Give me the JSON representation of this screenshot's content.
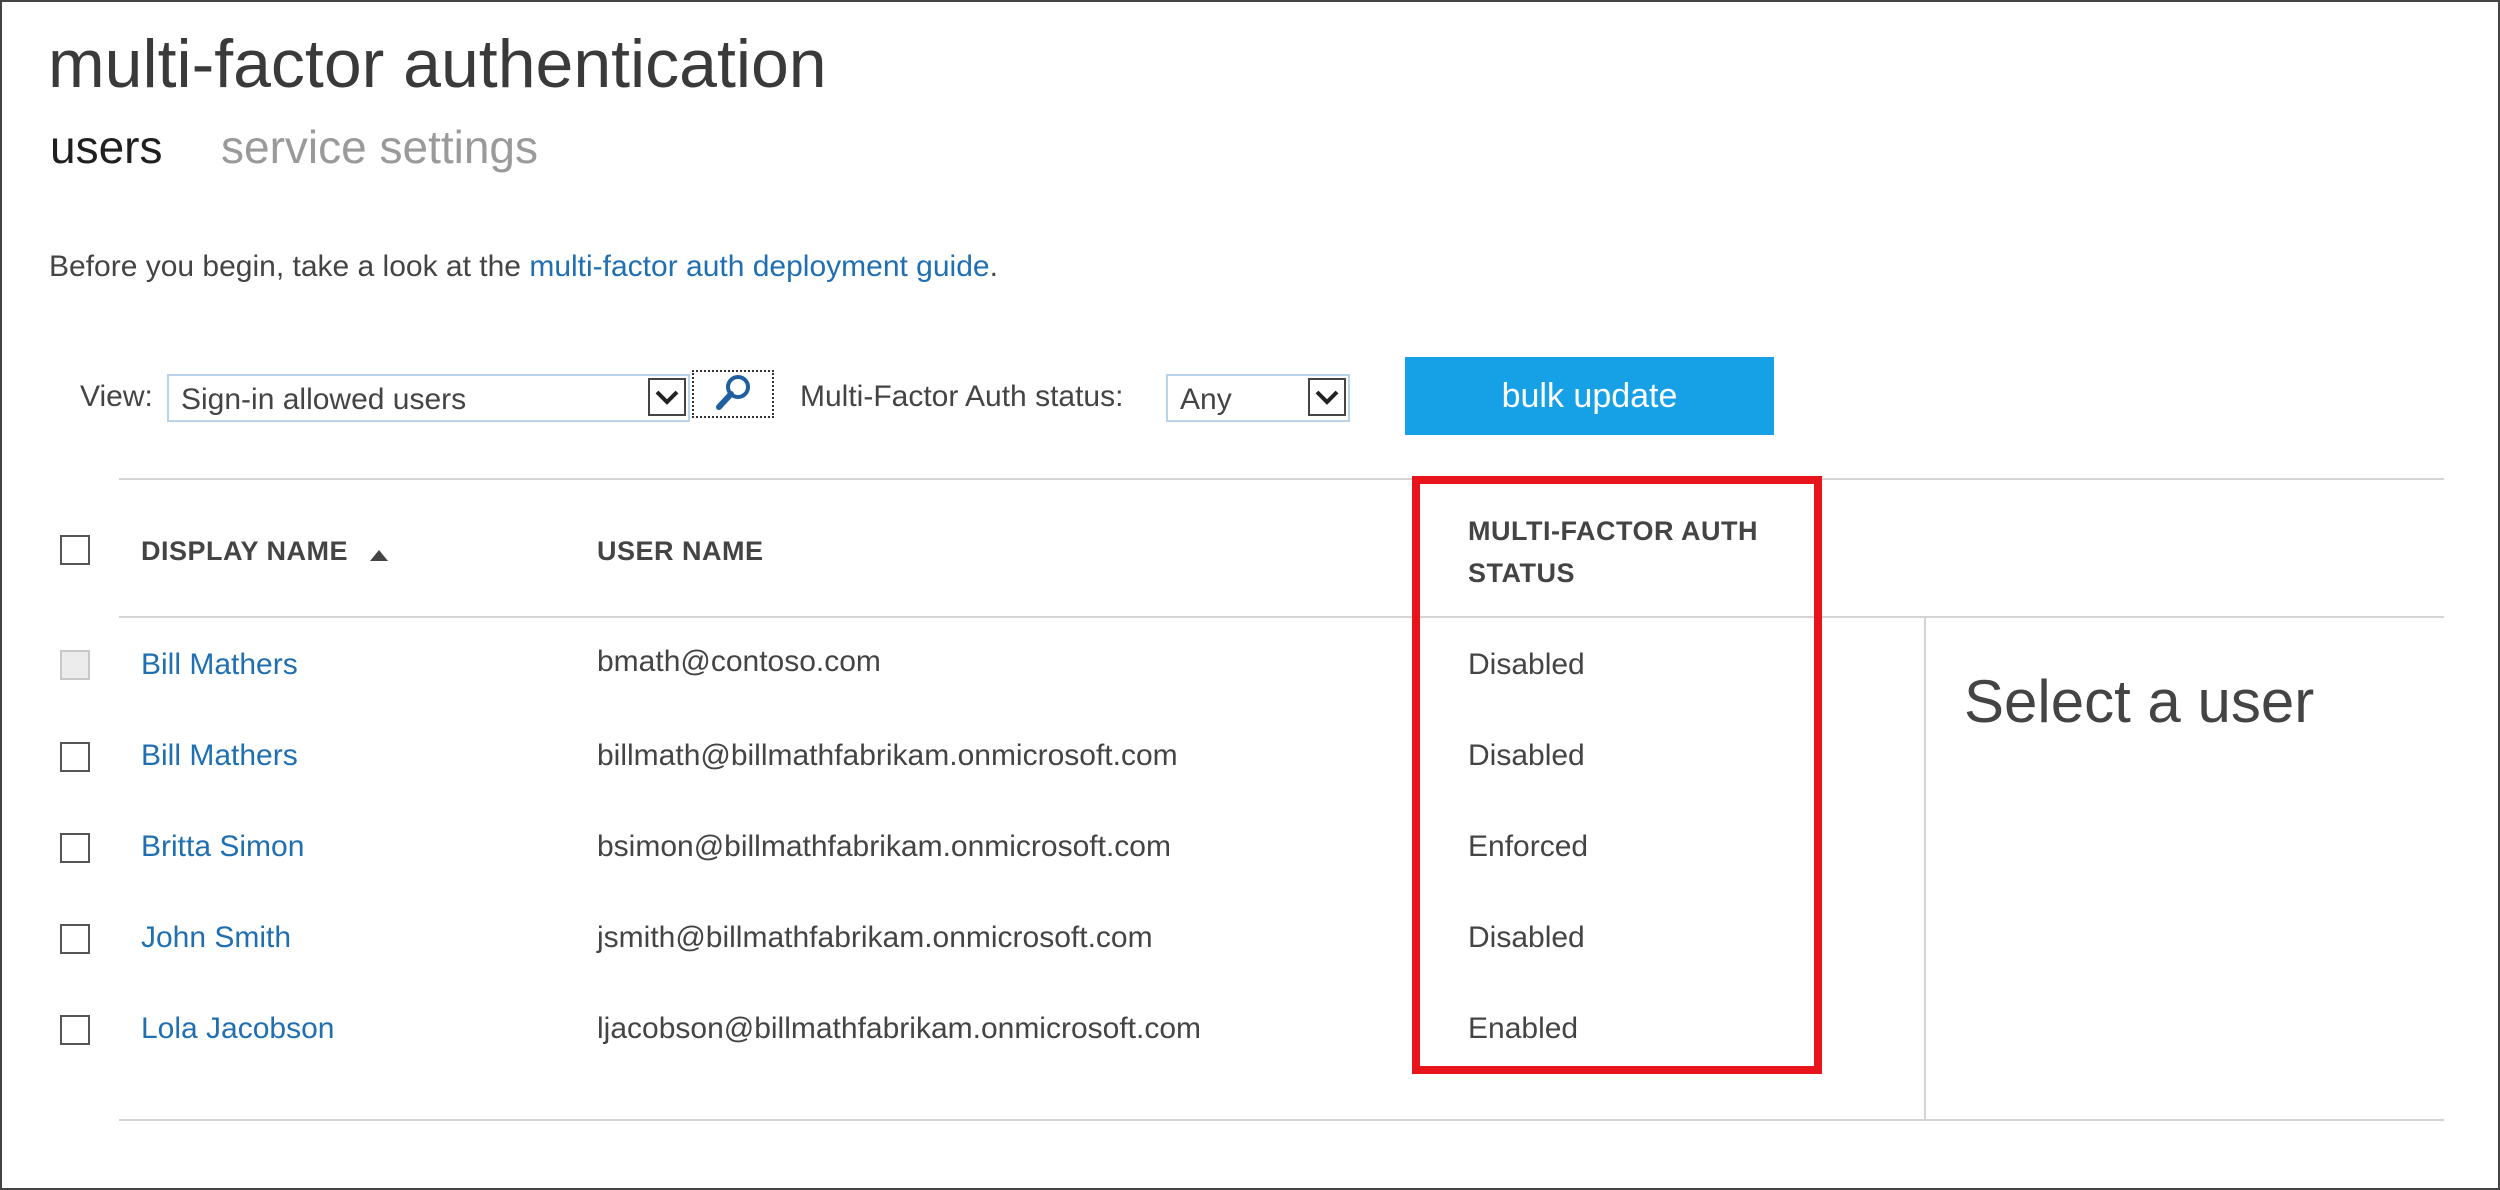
{
  "page": {
    "title": "multi-factor authentication",
    "tabs": [
      {
        "label": "users",
        "active": true
      },
      {
        "label": "service settings",
        "active": false
      }
    ]
  },
  "intro": {
    "prefix": "Before you begin, take a look at the ",
    "link_text": "multi-factor auth deployment guide",
    "suffix": "."
  },
  "filters": {
    "view_label": "View:",
    "view_value": "Sign-in allowed users",
    "mfa_label": "Multi-Factor Auth status:",
    "mfa_value": "Any",
    "search_icon": "search-icon",
    "dropdown_icon": "chevron-down-icon"
  },
  "bulk_update_label": "bulk update",
  "table": {
    "columns": {
      "display_name": "DISPLAY NAME",
      "user_name": "USER NAME",
      "status": "MULTI-FACTOR AUTH STATUS"
    },
    "sort_icon": "sort-ascending-icon",
    "rows": [
      {
        "display_name": "Bill Mathers",
        "user_name": "bmath@contoso.com",
        "status": "Disabled",
        "checkbox_disabled": true
      },
      {
        "display_name": "Bill Mathers",
        "user_name": "billmath@billmathfabrikam.onmicrosoft.com",
        "status": "Disabled",
        "checkbox_disabled": false
      },
      {
        "display_name": "Britta Simon",
        "user_name": "bsimon@billmathfabrikam.onmicrosoft.com",
        "status": "Enforced",
        "checkbox_disabled": false
      },
      {
        "display_name": "John Smith",
        "user_name": "jsmith@billmathfabrikam.onmicrosoft.com",
        "status": "Disabled",
        "checkbox_disabled": false
      },
      {
        "display_name": "Lola Jacobson",
        "user_name": "ljacobson@billmathfabrikam.onmicrosoft.com",
        "status": "Enabled",
        "checkbox_disabled": false
      }
    ]
  },
  "detail_pane": {
    "placeholder": "Select a user"
  },
  "colors": {
    "accent_button": "#16a0e6",
    "link": "#1f6fb2",
    "highlight_border": "#e8141b"
  }
}
